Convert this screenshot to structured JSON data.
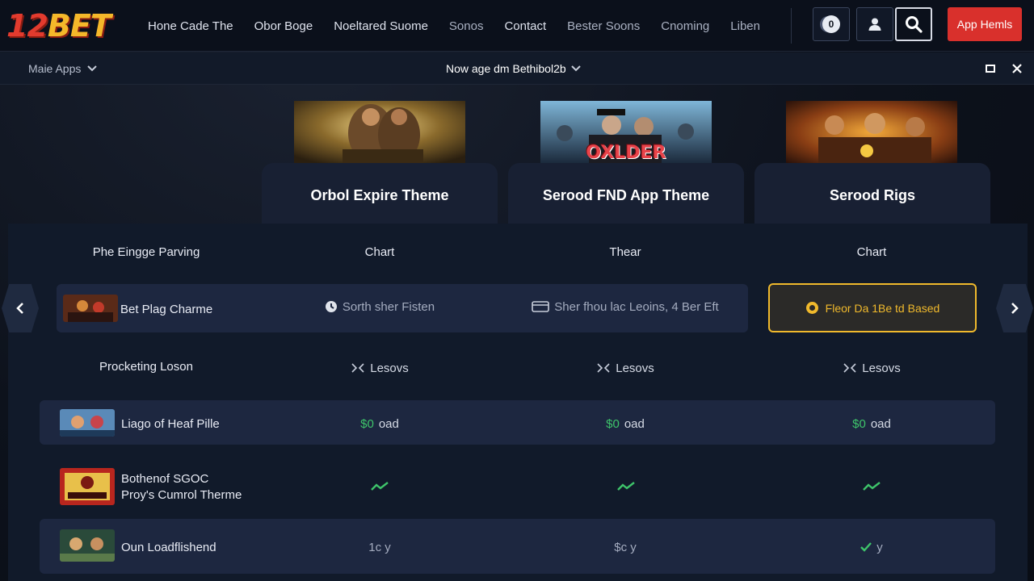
{
  "brand": {
    "logo_num": "12",
    "logo_text": "BET"
  },
  "nav": {
    "links": [
      "Hone Cade The",
      "Obor Boge",
      "Noeltared Suome",
      "Sonos",
      "Contact",
      "Bester Soons",
      "Cnoming",
      "Liben"
    ],
    "coin_badge": "0",
    "app_button": "App Hemls"
  },
  "subbar": {
    "left_label": "Maie Apps",
    "center_label": "Now age dm Bethibol2b"
  },
  "themes": [
    {
      "title": "Orbol Expire Theme",
      "thumb_text": ""
    },
    {
      "title": "Serood FND App Theme",
      "thumb_text": "OXLDER"
    },
    {
      "title": "Serood Rigs",
      "thumb_text": ""
    }
  ],
  "table": {
    "header_row": {
      "label": "Phe Eingge Parving",
      "cols": [
        "Chart",
        "Thear",
        "Chart"
      ]
    },
    "row1": {
      "label": "Bet Plag Charme",
      "col1": "Sorth sher Fisten",
      "col2": "Sher fhou lac Leoins, 4 Ber Eft",
      "col3": "Fleor Da 1Be td Based"
    },
    "row2": {
      "label": "Procketing Loson",
      "cols": [
        "Lesovs",
        "Lesovs",
        "Lesovs"
      ]
    },
    "row3": {
      "label": "Liago of Heaf Pille",
      "cols": [
        "oad",
        "oad",
        "oad"
      ],
      "prefix": "$0"
    },
    "row4": {
      "label_line1": "Bothenof SGOC",
      "label_line2": "Proy's Cumrol Therme"
    },
    "row5": {
      "label": "Oun Loadflishend",
      "cols": [
        "1c y",
        "$c y",
        "y"
      ]
    }
  },
  "colors": {
    "accent_gold": "#f0b92c",
    "accent_red": "#d9302c",
    "check_green": "#3ec46a"
  }
}
